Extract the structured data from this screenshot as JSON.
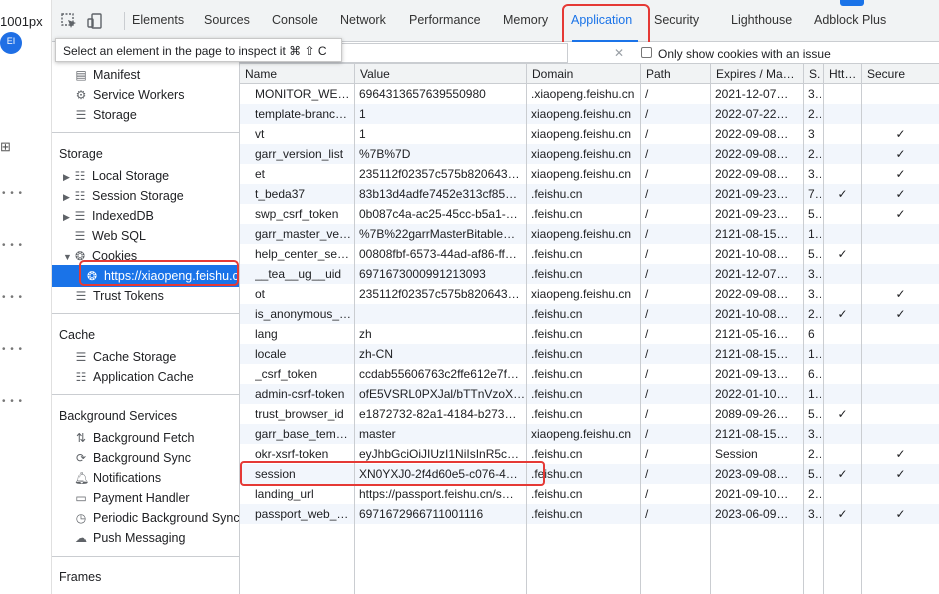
{
  "page_strip": {
    "width_readout": "1001px",
    "avatar": "EI",
    "grid_glyph": "⊞",
    "dots": "• • •"
  },
  "toolbar": {
    "tabs": [
      "Elements",
      "Sources",
      "Console",
      "Network",
      "Performance",
      "Memory",
      "Application",
      "Security",
      "Lighthouse",
      "Adblock Plus"
    ],
    "active_tab": "Application"
  },
  "tooltip": "Select an element in the page to inspect it  ⌘ ⇧ C",
  "filter": {
    "clear_glyph": "✕",
    "only_issue_label": "Only show cookies with an issue"
  },
  "sidebar": {
    "top_items": [
      "Manifest",
      "Service Workers",
      "Storage"
    ],
    "storage_header": "Storage",
    "storage_items": [
      "Local Storage",
      "Session Storage",
      "IndexedDB",
      "Web SQL",
      "Cookies"
    ],
    "cookie_origin": "https://xiaopeng.feishu.cn",
    "trust_tokens": "Trust Tokens",
    "cache_header": "Cache",
    "cache_items": [
      "Cache Storage",
      "Application Cache"
    ],
    "bg_header": "Background Services",
    "bg_items": [
      "Background Fetch",
      "Background Sync",
      "Notifications",
      "Payment Handler",
      "Periodic Background Sync",
      "Push Messaging"
    ],
    "frames_header": "Frames"
  },
  "table": {
    "columns": [
      "Name",
      "Value",
      "Domain",
      "Path",
      "Expires / Ma…",
      "S.",
      "Htt…",
      "Secure"
    ],
    "check": "✓",
    "rows": [
      {
        "name": "MONITOR_WE…",
        "value": "6964313657639550980",
        "domain": ".xiaopeng.feishu.cn",
        "path": "/",
        "expires": "2021-12-07…",
        "size": "3…",
        "http": "",
        "secure": ""
      },
      {
        "name": "template-branc…",
        "value": "1",
        "domain": "xiaopeng.feishu.cn",
        "path": "/",
        "expires": "2022-07-22…",
        "size": "2…",
        "http": "",
        "secure": ""
      },
      {
        "name": "vt",
        "value": "1",
        "domain": "xiaopeng.feishu.cn",
        "path": "/",
        "expires": "2022-09-08…",
        "size": "3",
        "http": "",
        "secure": "✓"
      },
      {
        "name": "garr_version_list",
        "value": "%7B%7D",
        "domain": "xiaopeng.feishu.cn",
        "path": "/",
        "expires": "2022-09-08…",
        "size": "2…",
        "http": "",
        "secure": "✓"
      },
      {
        "name": "et",
        "value": "235112f02357c575b820643…",
        "domain": "xiaopeng.feishu.cn",
        "path": "/",
        "expires": "2022-09-08…",
        "size": "3…",
        "http": "",
        "secure": "✓"
      },
      {
        "name": "t_beda37",
        "value": "83b13d4adfe7452e313cf85…",
        "domain": ".feishu.cn",
        "path": "/",
        "expires": "2021-09-23…",
        "size": "7…",
        "http": "✓",
        "secure": "✓"
      },
      {
        "name": "swp_csrf_token",
        "value": "0b087c4a-ac25-45cc-b5a1-…",
        "domain": ".feishu.cn",
        "path": "/",
        "expires": "2021-09-23…",
        "size": "5…",
        "http": "",
        "secure": "✓"
      },
      {
        "name": "garr_master_ve…",
        "value": "%7B%22garrMasterBitable…",
        "domain": "xiaopeng.feishu.cn",
        "path": "/",
        "expires": "2121-08-15…",
        "size": "1…",
        "http": "",
        "secure": ""
      },
      {
        "name": "help_center_se…",
        "value": "00808fbf-6573-44ad-af86-ff…",
        "domain": ".feishu.cn",
        "path": "/",
        "expires": "2021-10-08…",
        "size": "5…",
        "http": "✓",
        "secure": ""
      },
      {
        "name": "__tea__ug__uid",
        "value": "6971673000991213093",
        "domain": ".feishu.cn",
        "path": "/",
        "expires": "2021-12-07…",
        "size": "3…",
        "http": "",
        "secure": ""
      },
      {
        "name": "ot",
        "value": "235112f02357c575b820643…",
        "domain": "xiaopeng.feishu.cn",
        "path": "/",
        "expires": "2022-09-08…",
        "size": "3…",
        "http": "",
        "secure": "✓"
      },
      {
        "name": "is_anonymous_…",
        "value": "",
        "domain": ".feishu.cn",
        "path": "/",
        "expires": "2021-10-08…",
        "size": "2…",
        "http": "✓",
        "secure": "✓"
      },
      {
        "name": "lang",
        "value": "zh",
        "domain": ".feishu.cn",
        "path": "/",
        "expires": "2121-05-16…",
        "size": "6",
        "http": "",
        "secure": ""
      },
      {
        "name": "locale",
        "value": "zh-CN",
        "domain": ".feishu.cn",
        "path": "/",
        "expires": "2121-08-15…",
        "size": "1…",
        "http": "",
        "secure": ""
      },
      {
        "name": "_csrf_token",
        "value": "ccdab55606763c2ffe612e7f…",
        "domain": ".feishu.cn",
        "path": "/",
        "expires": "2021-09-13…",
        "size": "6…",
        "http": "",
        "secure": ""
      },
      {
        "name": "admin-csrf-token",
        "value": "ofE5VSRL0PXJal/bTTnVzoX…",
        "domain": ".feishu.cn",
        "path": "/",
        "expires": "2022-01-10…",
        "size": "1…",
        "http": "",
        "secure": ""
      },
      {
        "name": "trust_browser_id",
        "value": "e1872732-82a1-4184-b273…",
        "domain": ".feishu.cn",
        "path": "/",
        "expires": "2089-09-26…",
        "size": "5…",
        "http": "✓",
        "secure": ""
      },
      {
        "name": "garr_base_tem…",
        "value": "master",
        "domain": "xiaopeng.feishu.cn",
        "path": "/",
        "expires": "2121-08-15…",
        "size": "3…",
        "http": "",
        "secure": ""
      },
      {
        "name": "okr-xsrf-token",
        "value": "eyJhbGciOiJIUzI1NiIsInR5c…",
        "domain": ".feishu.cn",
        "path": "/",
        "expires": "Session",
        "size": "2…",
        "http": "",
        "secure": "✓"
      },
      {
        "name": "session",
        "value": "XN0YXJ0-2f4d60e5-c076-4…",
        "domain": ".feishu.cn",
        "path": "/",
        "expires": "2023-09-08…",
        "size": "5…",
        "http": "✓",
        "secure": "✓"
      },
      {
        "name": "landing_url",
        "value": "https://passport.feishu.cn/s…",
        "domain": ".feishu.cn",
        "path": "/",
        "expires": "2021-09-10…",
        "size": "2…",
        "http": "",
        "secure": ""
      },
      {
        "name": "passport_web_…",
        "value": "6971672966711001116",
        "domain": ".feishu.cn",
        "path": "/",
        "expires": "2023-06-09…",
        "size": "3…",
        "http": "✓",
        "secure": "✓"
      }
    ]
  }
}
